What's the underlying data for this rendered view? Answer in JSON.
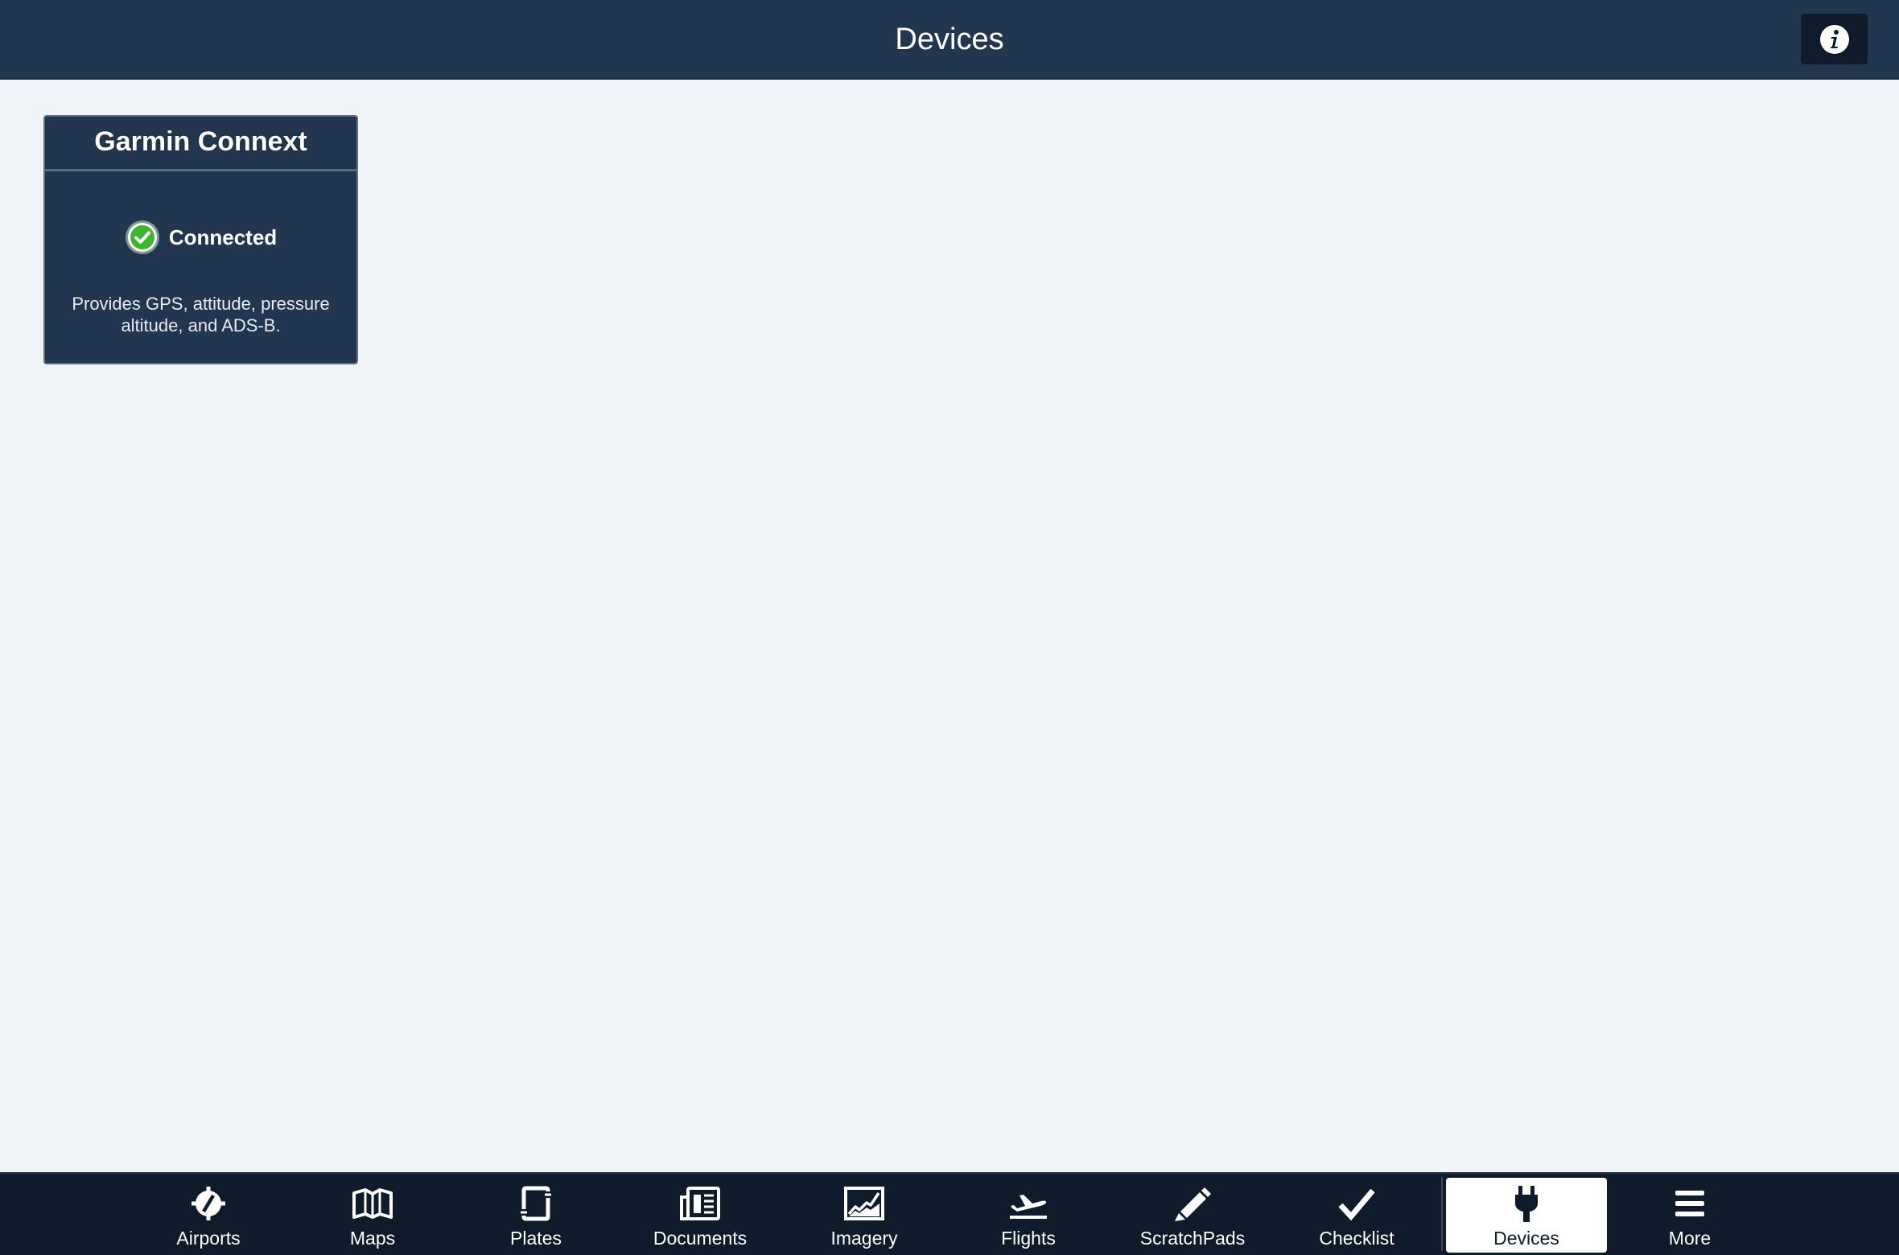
{
  "header": {
    "title": "Devices",
    "info_icon": "info-icon"
  },
  "device_card": {
    "title": "Garmin Connext",
    "status": "Connected",
    "status_icon": "checkmark-circle-icon",
    "status_color": "#3cb52f",
    "description": "Provides GPS, attitude, pressure altitude, and ADS-B."
  },
  "tabbar": {
    "active": "Devices",
    "tabs": [
      {
        "label": "Airports",
        "icon": "airports-icon"
      },
      {
        "label": "Maps",
        "icon": "map-icon"
      },
      {
        "label": "Plates",
        "icon": "plates-icon"
      },
      {
        "label": "Documents",
        "icon": "documents-icon"
      },
      {
        "label": "Imagery",
        "icon": "imagery-icon"
      },
      {
        "label": "Flights",
        "icon": "airplane-takeoff-icon"
      },
      {
        "label": "ScratchPads",
        "icon": "pencil-icon"
      },
      {
        "label": "Checklist",
        "icon": "checkmark-icon"
      },
      {
        "label": "Devices",
        "icon": "plug-icon"
      },
      {
        "label": "More",
        "icon": "hamburger-menu-icon"
      }
    ]
  },
  "colors": {
    "header_bg": "#22364f",
    "page_bg": "#f0f4f8",
    "tabbar_bg": "#0f1b2b",
    "active_tab_bg": "#ffffff"
  }
}
